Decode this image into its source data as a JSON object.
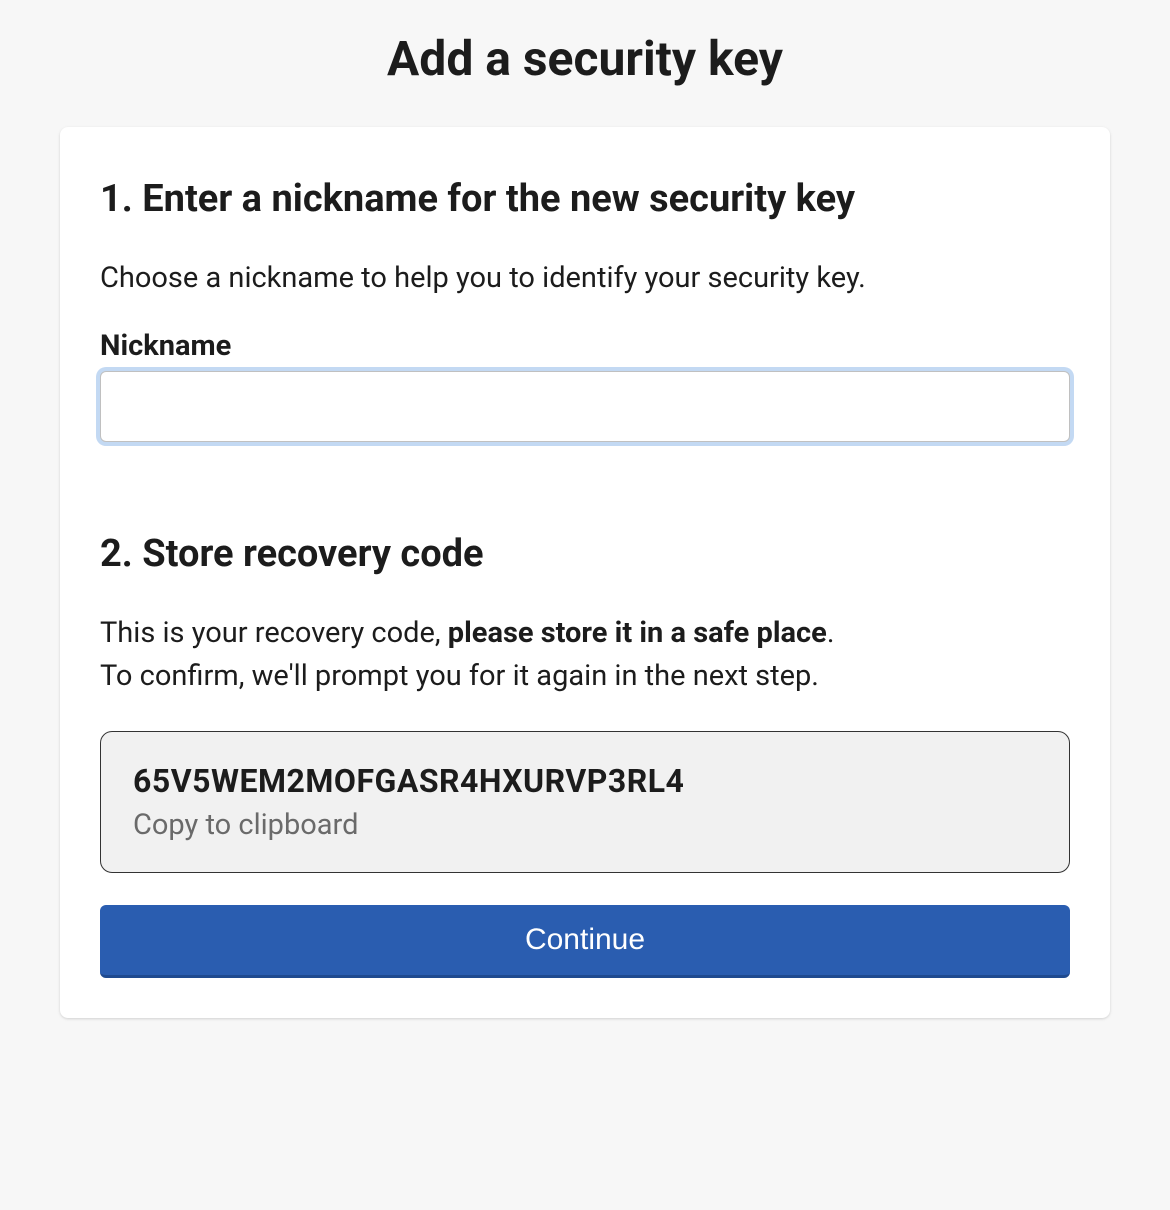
{
  "page": {
    "title": "Add a security key"
  },
  "section1": {
    "heading": "1. Enter a nickname for the new security key",
    "description": "Choose a nickname to help you to identify your security key.",
    "field_label": "Nickname",
    "nickname_value": ""
  },
  "section2": {
    "heading": "2. Store recovery code",
    "description_prefix": "This is your recovery code, ",
    "description_bold": "please store it in a safe place",
    "description_suffix1": ".",
    "description_suffix2": "To confirm, we'll prompt you for it again in the next step.",
    "recovery_code": "65V5WEM2MOFGASR4HXURVP3RL4",
    "copy_hint": "Copy to clipboard"
  },
  "actions": {
    "continue_label": "Continue"
  }
}
